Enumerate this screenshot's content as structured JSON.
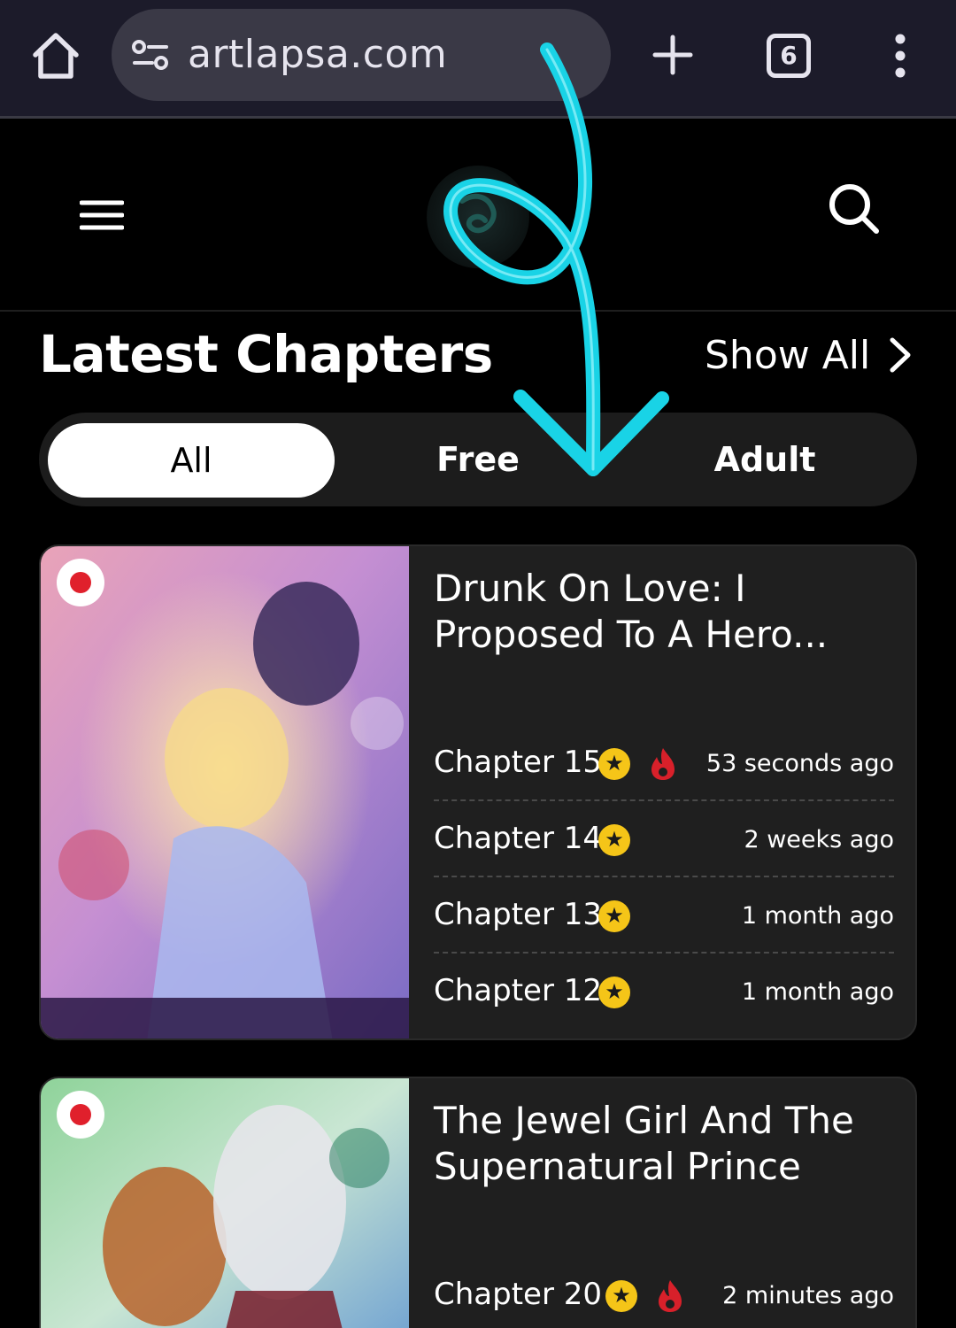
{
  "browser": {
    "url": "artlapsa.com",
    "tab_count": "6",
    "icons": [
      "home-icon",
      "site-info-icon",
      "plus-icon",
      "tabs-icon",
      "more-vert-icon"
    ]
  },
  "header": {
    "icons": [
      "hamburger-icon",
      "logo",
      "search-icon"
    ]
  },
  "section": {
    "title": "Latest Chapters",
    "show_all": "Show All"
  },
  "filters": [
    {
      "label": "All",
      "active": true
    },
    {
      "label": "Free",
      "active": false
    },
    {
      "label": "Adult",
      "active": false
    }
  ],
  "cards": [
    {
      "title_line1": "Drunk On Love: I",
      "title_line2": "Proposed To A Hero...",
      "chapters": [
        {
          "label": "Chapter 15",
          "time": "53 seconds ago",
          "star": true,
          "hot": true
        },
        {
          "label": "Chapter 14",
          "time": "2 weeks ago",
          "star": true,
          "hot": false
        },
        {
          "label": "Chapter 13",
          "time": "1 month ago",
          "star": true,
          "hot": false
        },
        {
          "label": "Chapter 12",
          "time": "1 month ago",
          "star": true,
          "hot": false
        }
      ]
    },
    {
      "title_line1": "The Jewel Girl And The",
      "title_line2": "Supernatural Prince",
      "chapters": [
        {
          "label": "Chapter 20",
          "time": "2 minutes ago",
          "star": true,
          "hot": true
        }
      ]
    }
  ],
  "colors": {
    "browser_bar": "#1c1b2a",
    "url_pill": "#3a3946",
    "card_bg": "#1f1f1f",
    "star": "#f5c518",
    "fire": "#d8202a",
    "annotation_arrow": "#19d3e6"
  }
}
